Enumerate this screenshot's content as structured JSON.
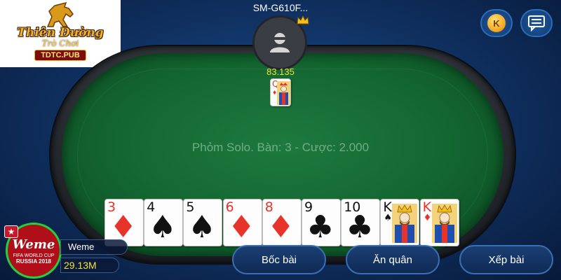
{
  "logo": {
    "title": "Thiên Đường",
    "subtitle": "Trò Chơi",
    "domain": "TDTC.PUB"
  },
  "top_buttons": {
    "coin_icon": "coin-k-icon",
    "coin_letter": "K",
    "chat_icon": "chat-icon"
  },
  "opponent": {
    "name": "SM-G610F...",
    "score": "83.135",
    "card": {
      "rank": "Q",
      "suit": "♦",
      "color": "red"
    }
  },
  "table": {
    "info": "Phỏm Solo. Bàn: 3 - Cược: 2.000"
  },
  "hand": [
    {
      "rank": "3",
      "suit": "♦",
      "color": "red"
    },
    {
      "rank": "4",
      "suit": "♠",
      "color": "black"
    },
    {
      "rank": "5",
      "suit": "♠",
      "color": "black"
    },
    {
      "rank": "6",
      "suit": "♦",
      "color": "red"
    },
    {
      "rank": "8",
      "suit": "♦",
      "color": "red"
    },
    {
      "rank": "9",
      "suit": "♣",
      "color": "black"
    },
    {
      "rank": "10",
      "suit": "♣",
      "color": "black"
    },
    {
      "rank": "K",
      "suit": "♠",
      "color": "black"
    },
    {
      "rank": "K",
      "suit": "♦",
      "color": "red"
    }
  ],
  "player": {
    "name": "Weme",
    "money": "29.13M",
    "avatar_text": "Weme",
    "avatar_sub": "FIFA WORLD CUP",
    "avatar_event": "RUSSIA 2018",
    "badge_icon": "star-icon"
  },
  "actions": {
    "draw": "Bốc bài",
    "eat": "Ăn quân",
    "sort": "Xếp bài"
  },
  "colors": {
    "felt": "#136530",
    "background": "#0f2f5e",
    "score_yellow": "#f3e03a",
    "avatar_ring": "#1fd43a"
  }
}
